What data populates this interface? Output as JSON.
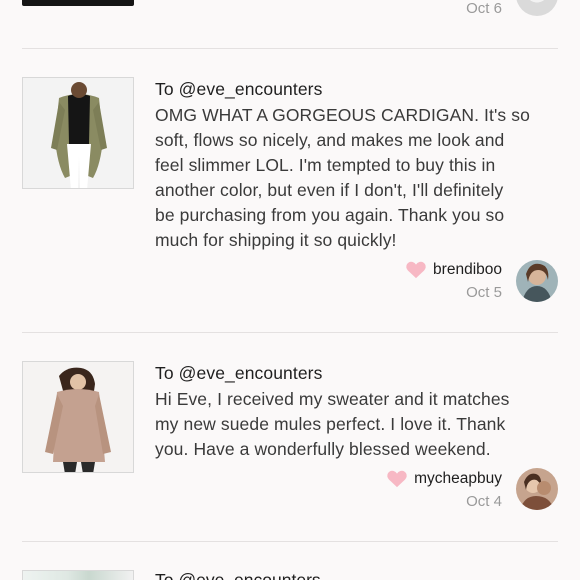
{
  "top": {
    "date": "Oct 6"
  },
  "reviews": [
    {
      "to": "To @eve_encounters",
      "body_lines": [
        "OMG WHAT A GORGEOUS CARDIGAN. It's so",
        "soft, flows so nicely, and makes me look and",
        "feel slimmer LOL. I'm tempted to buy this in",
        "another color, but even if I don't, I'll definitely",
        "be purchasing from you again. Thank you so",
        "much for shipping it so quickly!"
      ],
      "username": "brendiboo",
      "date": "Oct 5",
      "heart_color": "#f7b8c4"
    },
    {
      "to": "To @eve_encounters",
      "body_lines": [
        "Hi Eve, I received my sweater and it matches",
        "my new suede mules perfect. I love it. Thank",
        "you. Have a wonderfully blessed weekend."
      ],
      "username": "mycheapbuy",
      "date": "Oct 4",
      "heart_color": "#f7b8c4"
    }
  ],
  "bottom": {
    "to": "To @eve_encounters"
  }
}
